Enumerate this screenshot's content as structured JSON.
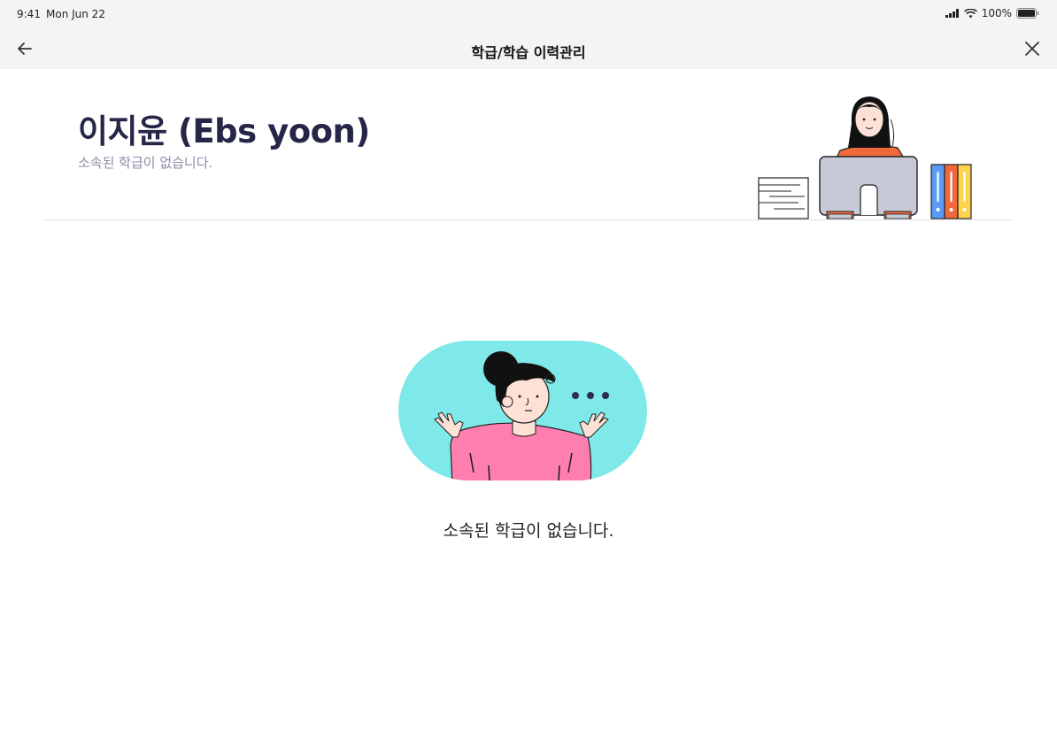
{
  "status": {
    "time": "9:41",
    "date": "Mon Jun 22",
    "battery": "100%"
  },
  "nav": {
    "title": "학급/학습 이력관리",
    "back_icon": "arrow-left-icon",
    "close_icon": "close-icon"
  },
  "profile": {
    "name": "이지윤 (Ebs yoon)",
    "subtitle": "소속된 학급이 없습니다."
  },
  "empty_state": {
    "message": "소속된 학급이 없습니다."
  },
  "colors": {
    "nav_bg": "#f4f4f4",
    "name": "#262648",
    "subtitle": "#8a8ca6",
    "illus_bg": "#7fe8e8",
    "shirt": "#ff7eb0",
    "monitor": "#c7c9d6",
    "binder_blue": "#5a9cf5",
    "binder_red": "#f0683b",
    "binder_yellow": "#ffd34d"
  }
}
